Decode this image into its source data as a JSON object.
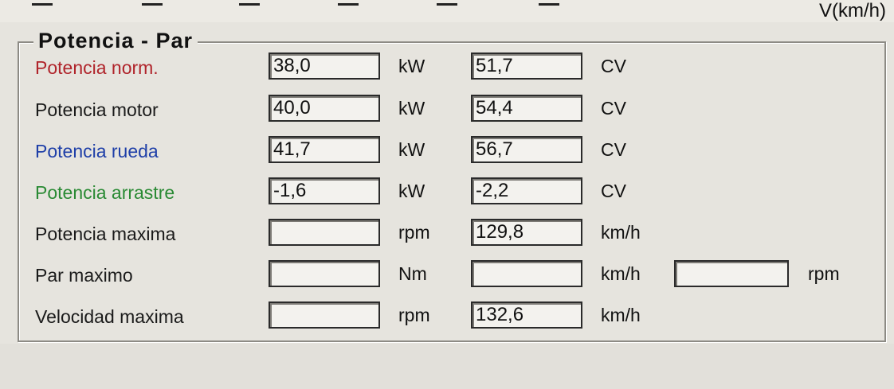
{
  "header": {
    "axis_unit_label": "V(km/h)"
  },
  "group": {
    "title": "Potencia - Par"
  },
  "colors": {
    "norm": "#b0242b",
    "motor": "#1a1a1a",
    "rueda": "#1f3fa8",
    "arrastre": "#2a8a34",
    "default": "#1a1a1a"
  },
  "rows": [
    {
      "label": "Potencia norm.",
      "value1": "38,0",
      "unit1": "kW",
      "value2": "51,7",
      "unit2": "CV"
    },
    {
      "label": "Potencia motor",
      "value1": "40,0",
      "unit1": "kW",
      "value2": "54,4",
      "unit2": "CV"
    },
    {
      "label": "Potencia rueda",
      "value1": "41,7",
      "unit1": "kW",
      "value2": "56,7",
      "unit2": "CV"
    },
    {
      "label": "Potencia arrastre",
      "value1": "-1,6",
      "unit1": "kW",
      "value2": "-2,2",
      "unit2": "CV"
    },
    {
      "label": "Potencia maxima",
      "value1": "",
      "unit1": "rpm",
      "value2": "129,8",
      "unit2": "km/h"
    },
    {
      "label": "Par maximo",
      "value1": "",
      "unit1": "Nm",
      "value2": "",
      "unit2": "km/h",
      "value3": "",
      "unit3": "rpm"
    },
    {
      "label": "Velocidad maxima",
      "value1": "",
      "unit1": "rpm",
      "value2": "132,6",
      "unit2": "km/h"
    }
  ]
}
